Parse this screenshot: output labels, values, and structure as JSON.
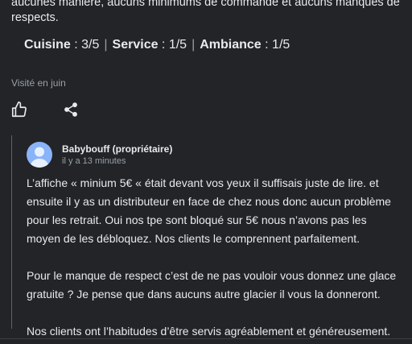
{
  "review": {
    "text_partial": "aucunes manière, aucuns minimums de commande et aucuns manques de respects.",
    "ratings": [
      {
        "label": "Cuisine",
        "value": "3/5"
      },
      {
        "label": "Service",
        "value": "1/5"
      },
      {
        "label": "Ambiance",
        "value": "1/5"
      }
    ],
    "separator": "|",
    "visited": "Visité en juin"
  },
  "icons": {
    "like": "thumbs-up-icon",
    "share": "share-icon"
  },
  "owner_reply": {
    "name": "Babybouff (propriétaire)",
    "time": "il y a 13 minutes",
    "body": "L’affiche « minium 5€ «  était devant vos yeux il suffisais juste de lire. et ensuite il y as un distributeur en face de chez nous donc aucun problème pour les retrait. Oui nos tpe sont bloqué sur 5€ nous n’avons pas les moyen de les débloquez. Nos clients le comprennent parfaitement.\n\nPour le manque de respect c’est de ne pas vouloir vous donnez une glace gratuite ? Je pense que dans aucuns autre glacier il vous la donneront.\n\nNos clients ont l’habitudes d’être servis agréablement et généreusement."
  },
  "colors": {
    "background": "#222427",
    "text": "#e8eaed",
    "muted": "#9aa0a6",
    "avatar": "#8ab4f8"
  }
}
